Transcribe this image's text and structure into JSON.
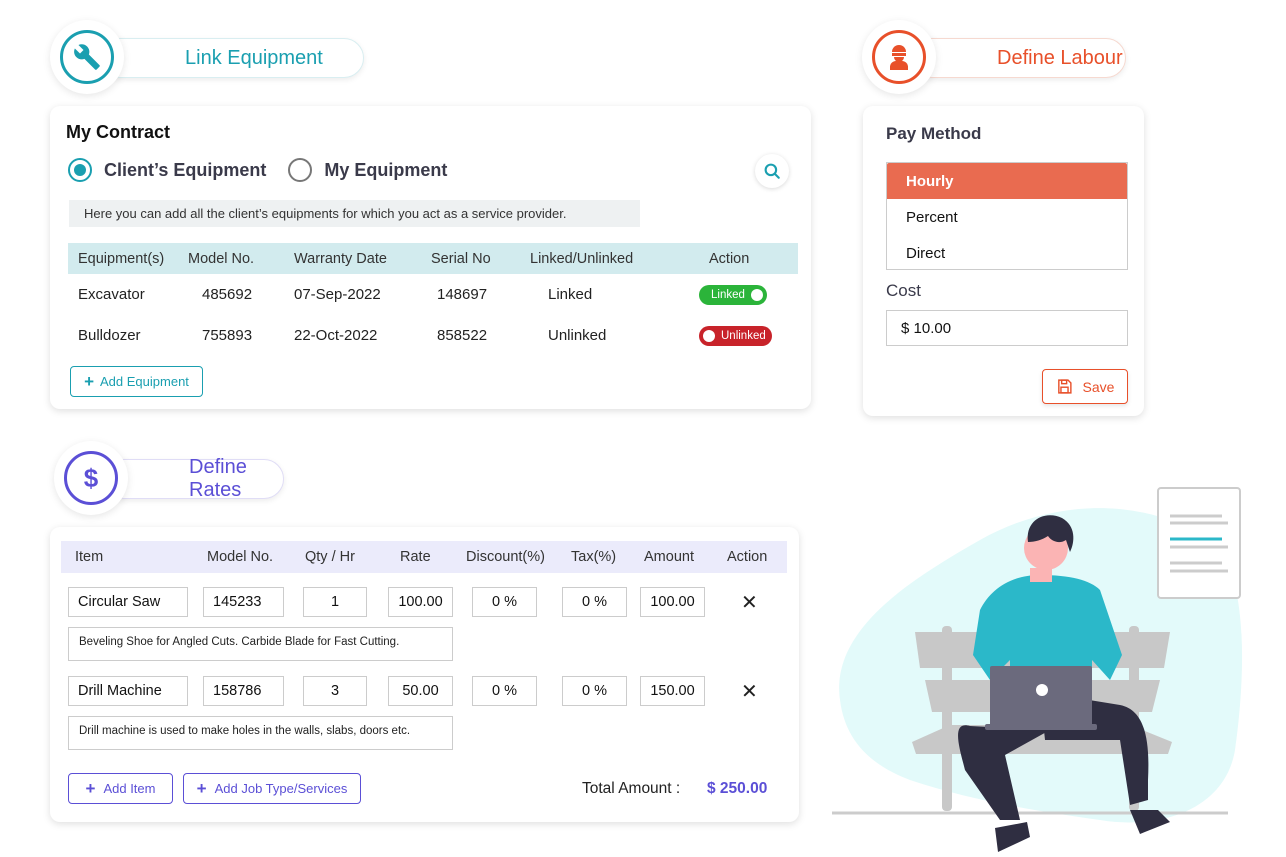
{
  "link_equipment": {
    "title": "Link Equipment",
    "icon": "wrench-icon",
    "card_title": "My Contract",
    "radios": [
      {
        "label": "Client’s Equipment",
        "selected": true
      },
      {
        "label": "My Equipment",
        "selected": false
      }
    ],
    "info_text": "Here you can add all the client’s equipments for which you act as a service provider.",
    "table": {
      "headers": [
        "Equipment(s)",
        "Model No.",
        "Warranty Date",
        "Serial No",
        "Linked/Unlinked",
        "Action"
      ],
      "rows": [
        {
          "equipment": "Excavator",
          "model": "485692",
          "warranty": "07-Sep-2022",
          "serial": "148697",
          "status": "Linked",
          "toggle": "Linked",
          "toggle_on": true
        },
        {
          "equipment": "Bulldozer",
          "model": "755893",
          "warranty": "22-Oct-2022",
          "serial": "858522",
          "status": "Unlinked",
          "toggle": "Unlinked",
          "toggle_on": false
        }
      ]
    },
    "add_button": "Add Equipment"
  },
  "define_labour": {
    "title": "Define Labour",
    "icon": "worker-icon",
    "pay_method_label": "Pay Method",
    "pay_options": [
      "Hourly",
      "Percent",
      "Direct"
    ],
    "selected_option": "Hourly",
    "cost_label": "Cost",
    "cost_value": "$ 10.00",
    "save_button": "Save"
  },
  "define_rates": {
    "title": "Define Rates",
    "icon": "dollar-icon",
    "headers": [
      "Item",
      "Model No.",
      "Qty / Hr",
      "Rate",
      "Discount(%)",
      "Tax(%)",
      "Amount",
      "Action"
    ],
    "rows": [
      {
        "item": "Circular Saw",
        "model": "145233",
        "qty": "1",
        "rate": "100.00",
        "discount": "0 %",
        "tax": "0 %",
        "amount": "100.00",
        "description": "Beveling Shoe for Angled Cuts. Carbide Blade for Fast Cutting."
      },
      {
        "item": "Drill Machine",
        "model": "158786",
        "qty": "3",
        "rate": "50.00",
        "discount": "0 %",
        "tax": "0 %",
        "amount": "150.00",
        "description": "Drill machine is used to make holes in the walls, slabs, doors etc."
      }
    ],
    "add_item_button": "Add Item",
    "add_job_button": "Add Job Type/Services",
    "total_label": "Total Amount :",
    "total_value": "$ 250.00"
  },
  "colors": {
    "teal": "#1a9fb0",
    "orange": "#e8502a",
    "purple": "#5b4fd6",
    "linked_green": "#2bb43a",
    "unlinked_red": "#c8232a"
  }
}
